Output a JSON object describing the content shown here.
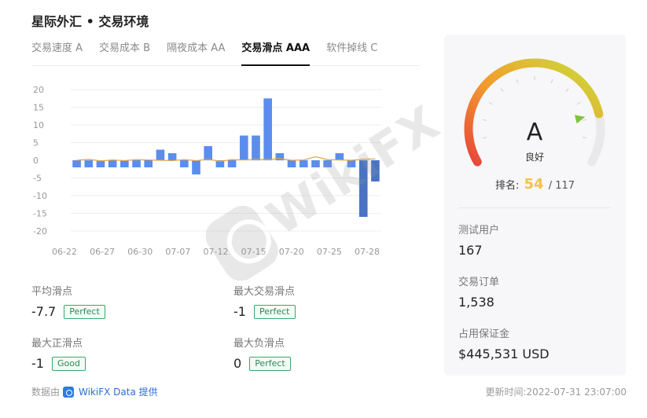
{
  "header": {
    "title": "星际外汇 • 交易环境"
  },
  "tabs": [
    {
      "label": "交易速度 A",
      "active": false
    },
    {
      "label": "交易成本 B",
      "active": false
    },
    {
      "label": "隔夜成本 AA",
      "active": false
    },
    {
      "label": "交易滑点 AAA",
      "active": true
    },
    {
      "label": "软件掉线 C",
      "active": false
    }
  ],
  "chart_data": {
    "type": "bar",
    "yticks": [
      20,
      15,
      10,
      5,
      0,
      -5,
      -10,
      -15,
      -20
    ],
    "ylim": [
      -20,
      20
    ],
    "xticks": [
      "06-22",
      "06-27",
      "06-30",
      "07-07",
      "07-12",
      "07-15",
      "07-20",
      "07-25",
      "07-28"
    ],
    "values": [
      -2,
      -2,
      -2,
      -2,
      -2,
      -2,
      -2,
      3,
      2,
      -2,
      -4,
      4,
      -2,
      -2,
      7,
      7,
      17.5,
      2,
      -2,
      -2,
      -2,
      -2,
      2,
      -2,
      -16,
      -6
    ],
    "line": [
      0,
      0.3,
      -0.2,
      0.1,
      -0.1,
      0.2,
      0.1,
      0,
      -0.1,
      0.2,
      -0.1,
      0.3,
      -0.3,
      0.2,
      0.1,
      0.3,
      0.2,
      0.5,
      0,
      0.1,
      1,
      0.2,
      0.1,
      0,
      0.3,
      0.4
    ],
    "colors": {
      "bar": "#5b8def",
      "bar_dark": "#4a73c4",
      "line": "#e8a33d"
    },
    "grid": true
  },
  "metrics": {
    "avg_slip": {
      "label": "平均滑点",
      "value": "-7.7",
      "badge": "Perfect"
    },
    "max_slip": {
      "label": "最大交易滑点",
      "value": "-1",
      "badge": "Perfect"
    },
    "max_pos": {
      "label": "最大正滑点",
      "value": "-1",
      "badge": "Good"
    },
    "max_neg": {
      "label": "最大负滑点",
      "value": "0",
      "badge": "Perfect"
    }
  },
  "footer": {
    "source_prefix": "数据由",
    "source_brand": "WikiFX Data 提供",
    "updated": "更新时间:2022-07-31 23:07:00"
  },
  "rating": {
    "grade": "A",
    "grade_text": "良好",
    "rank_label": "排名:",
    "rank": "54",
    "rank_total": "/ 117",
    "gauge_level": 0.82
  },
  "stats": [
    {
      "label": "测试用户",
      "value": "167"
    },
    {
      "label": "交易订单",
      "value": "1,538"
    },
    {
      "label": "占用保证金",
      "value": "$445,531 USD"
    }
  ],
  "watermark": "WikiFX"
}
